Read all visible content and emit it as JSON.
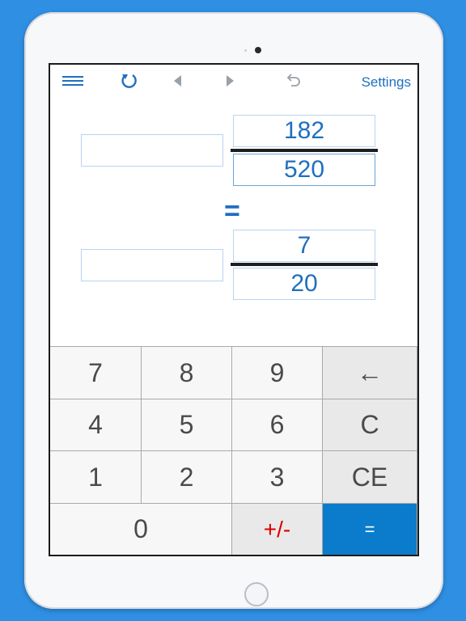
{
  "toolbar": {
    "menu_icon": "hamburger-menu-icon",
    "refresh_icon": "refresh-icon",
    "back_icon": "triangle-left-icon",
    "forward_icon": "triangle-right-icon",
    "undo_icon": "undo-icon",
    "settings_label": "Settings"
  },
  "input_fraction": {
    "whole": "",
    "numerator": "182",
    "denominator": "520"
  },
  "equals_label": "=",
  "result_fraction": {
    "whole": "",
    "numerator": "7",
    "denominator": "20"
  },
  "keypad": {
    "k7": "7",
    "k8": "8",
    "k9": "9",
    "backspace": "←",
    "k4": "4",
    "k5": "5",
    "k6": "6",
    "clear": "C",
    "k1": "1",
    "k2": "2",
    "k3": "3",
    "clear_entry": "CE",
    "k0": "0",
    "plus_minus": "+/-",
    "equals": "="
  },
  "colors": {
    "background": "#2f8fe3",
    "accent": "#1f6fbf",
    "equals_key": "#0a7ccb",
    "plus_minus_text": "#e00000"
  }
}
